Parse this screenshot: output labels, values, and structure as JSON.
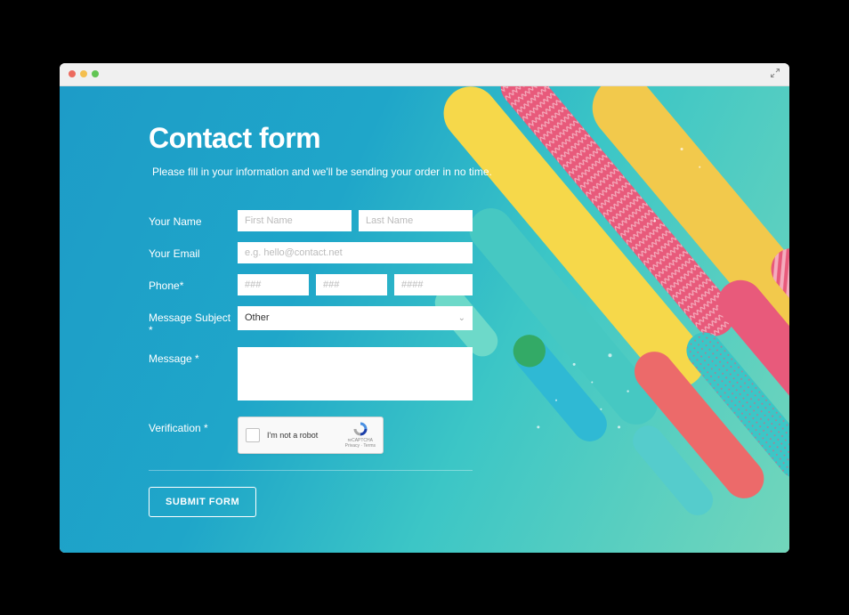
{
  "header": {
    "title": "Contact form",
    "subtitle": "Please fill in your information and we'll be sending your order in no time."
  },
  "form": {
    "name": {
      "label": "Your Name",
      "first_placeholder": "First Name",
      "last_placeholder": "Last Name"
    },
    "email": {
      "label": "Your Email",
      "placeholder": "e.g. hello@contact.net"
    },
    "phone": {
      "label": "Phone*",
      "area_placeholder": "###",
      "prefix_placeholder": "###",
      "line_placeholder": "####"
    },
    "subject": {
      "label": "Message Subject *",
      "selected": "Other"
    },
    "message": {
      "label": "Message *"
    },
    "verification": {
      "label": "Verification *",
      "checkbox_label": "I'm not a robot",
      "badge_name": "reCAPTCHA",
      "badge_links": "Privacy · Terms"
    },
    "submit_label": "SUBMIT FORM"
  }
}
